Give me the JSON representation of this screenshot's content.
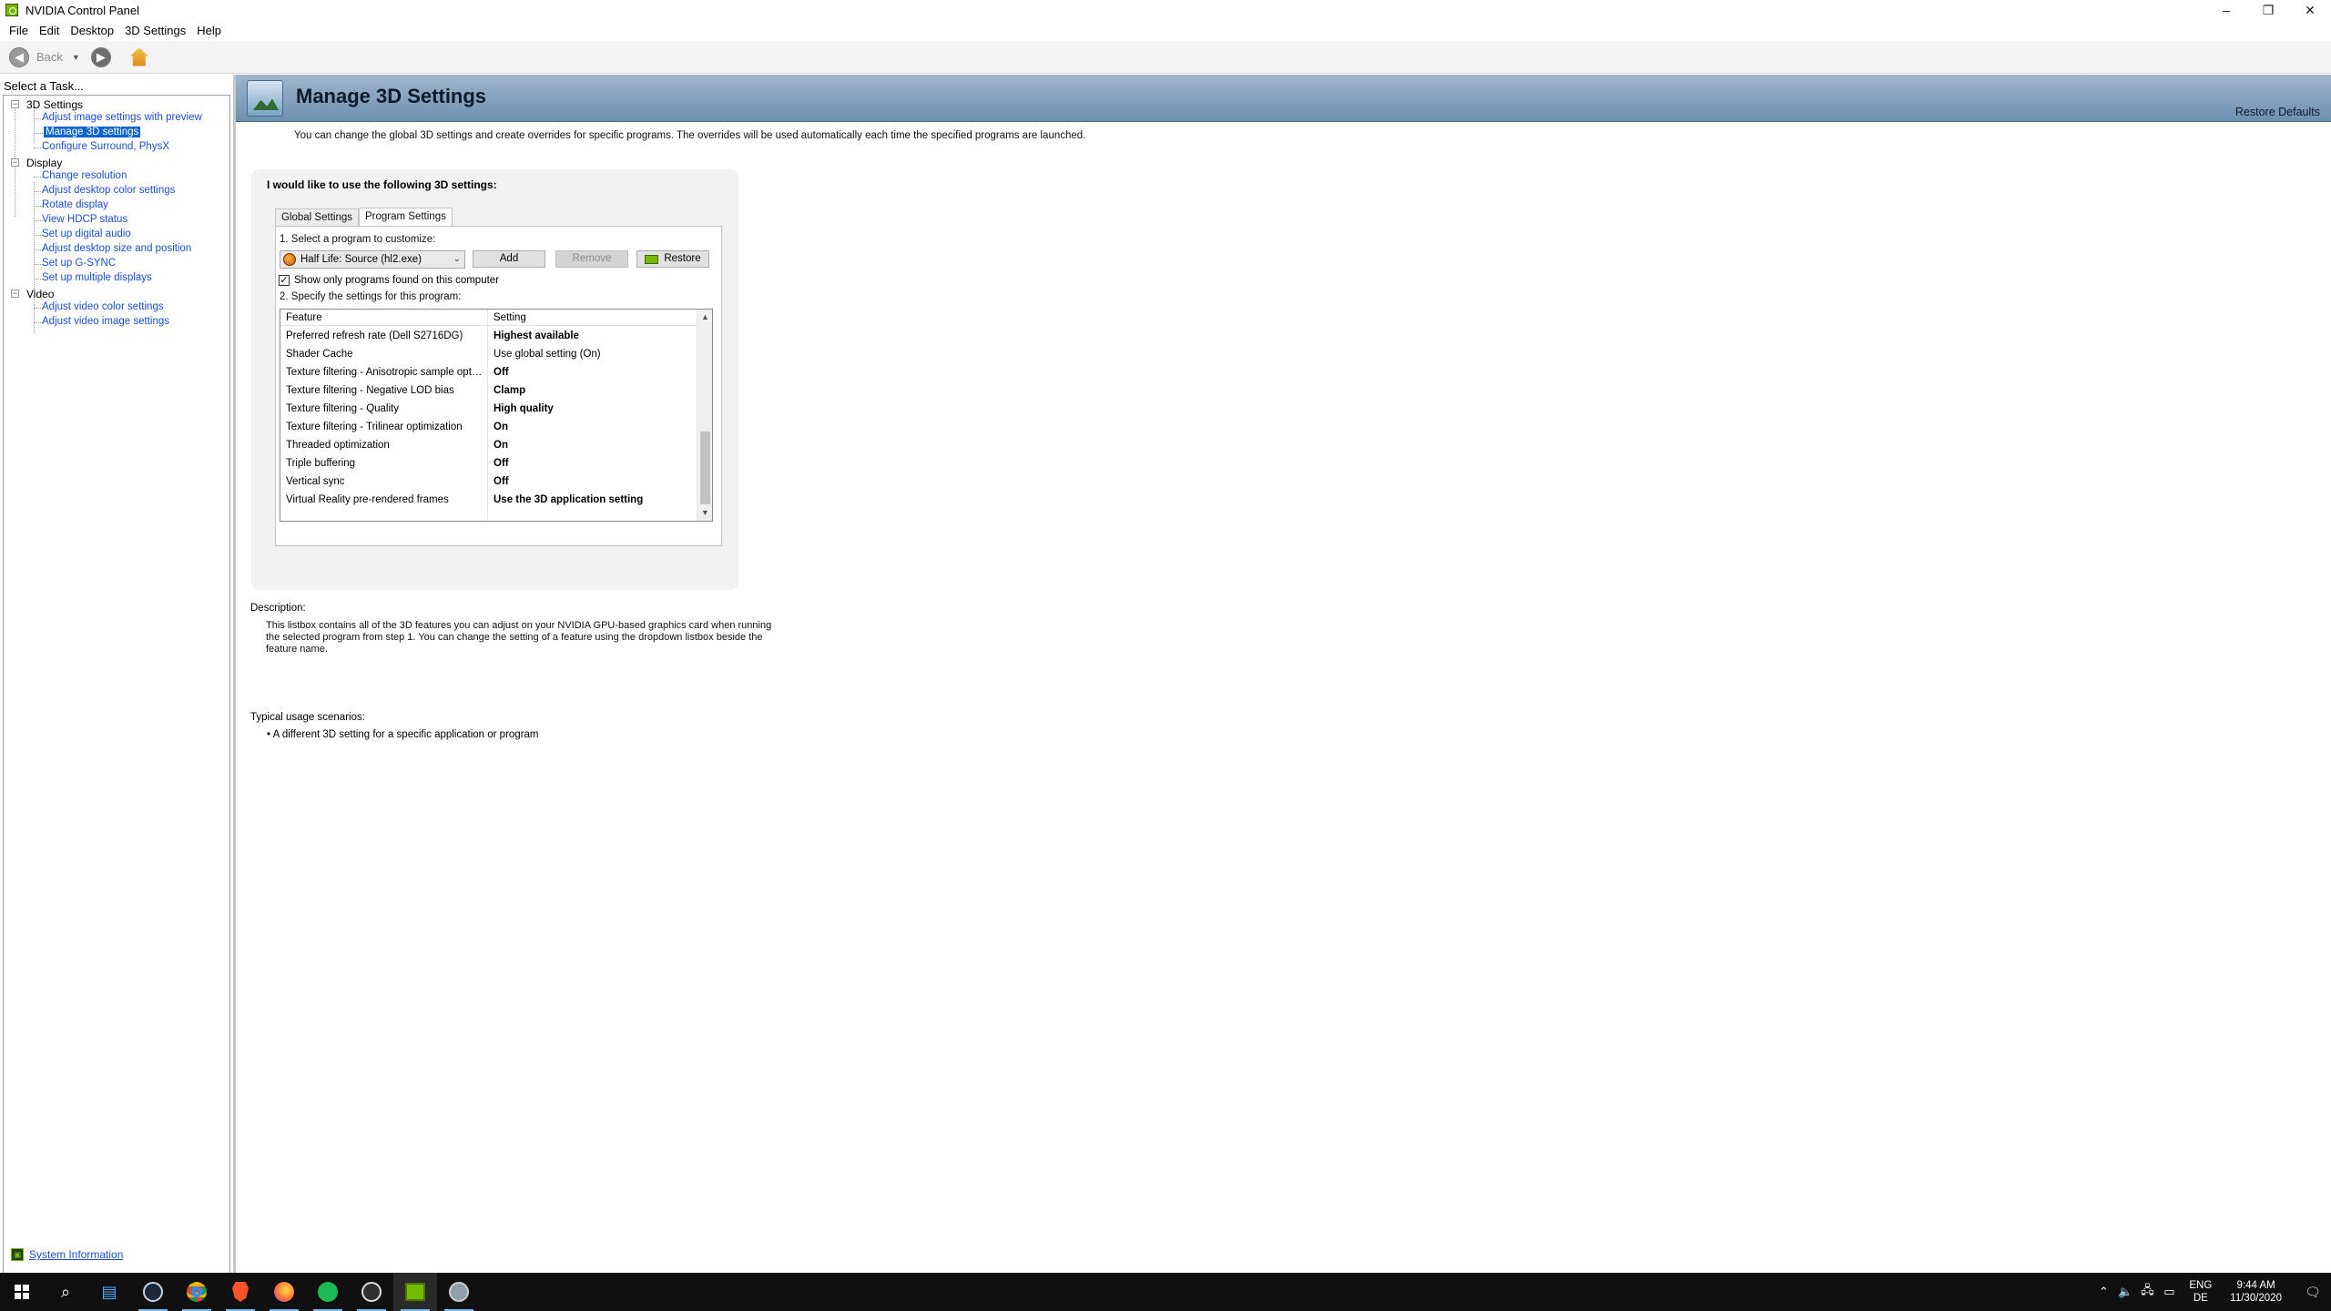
{
  "window": {
    "title": "NVIDIA Control Panel",
    "controls": {
      "minimize": "–",
      "restore": "❐",
      "close": "✕"
    }
  },
  "menu": [
    "File",
    "Edit",
    "Desktop",
    "3D Settings",
    "Help"
  ],
  "toolbar": {
    "back_label": "Back"
  },
  "left_pane": {
    "header": "Select a Task...",
    "groups": [
      {
        "label": "3D Settings",
        "items": [
          "Adjust image settings with preview",
          "Manage 3D settings",
          "Configure Surround, PhysX"
        ]
      },
      {
        "label": "Display",
        "items": [
          "Change resolution",
          "Adjust desktop color settings",
          "Rotate display",
          "View HDCP status",
          "Set up digital audio",
          "Adjust desktop size and position",
          "Set up G-SYNC",
          "Set up multiple displays"
        ]
      },
      {
        "label": "Video",
        "items": [
          "Adjust video color settings",
          "Adjust video image settings"
        ]
      }
    ],
    "selected": "Manage 3D settings",
    "system_info": "System Information"
  },
  "main": {
    "title": "Manage 3D Settings",
    "restore_defaults": "Restore Defaults",
    "intro": "You can change the global 3D settings and create overrides for specific programs. The overrides will be used automatically each time the specified programs are launched.",
    "panel_heading": "I would like to use the following 3D settings:",
    "tabs": [
      "Global Settings",
      "Program Settings"
    ],
    "active_tab": "Program Settings",
    "step1": "1. Select a program to customize:",
    "program": "Half Life: Source (hl2.exe)",
    "buttons": {
      "add": "Add",
      "remove": "Remove",
      "restore": "Restore"
    },
    "checkbox": {
      "label": "Show only programs found on this computer",
      "checked": true
    },
    "step2": "2. Specify the settings for this program:",
    "grid": {
      "headers": [
        "Feature",
        "Setting"
      ],
      "rows": [
        {
          "feature": "Preferred refresh rate (Dell S2716DG)",
          "setting": "Highest available",
          "bold": true
        },
        {
          "feature": "Shader Cache",
          "setting": "Use global setting (On)",
          "bold": false
        },
        {
          "feature": "Texture filtering - Anisotropic sample opti...",
          "setting": "Off",
          "bold": true
        },
        {
          "feature": "Texture filtering - Negative LOD bias",
          "setting": "Clamp",
          "bold": true
        },
        {
          "feature": "Texture filtering - Quality",
          "setting": "High quality",
          "bold": true
        },
        {
          "feature": "Texture filtering - Trilinear optimization",
          "setting": "On",
          "bold": true
        },
        {
          "feature": "Threaded optimization",
          "setting": "On",
          "bold": true
        },
        {
          "feature": "Triple buffering",
          "setting": "Off",
          "bold": true
        },
        {
          "feature": "Vertical sync",
          "setting": "Off",
          "bold": true
        },
        {
          "feature": "Virtual Reality pre-rendered frames",
          "setting": "Use the 3D application setting",
          "bold": true
        }
      ]
    },
    "description_label": "Description:",
    "description": "This listbox contains all of the 3D features you can adjust on your NVIDIA GPU-based graphics card when running the selected program from step 1. You can change the setting of a feature using the dropdown listbox beside the feature name.",
    "usage_label": "Typical usage scenarios:",
    "usage_items": [
      "A different 3D setting for a specific application or program"
    ]
  },
  "taskbar": {
    "icons": [
      "windows-start-icon",
      "search-icon",
      "task-view-icon",
      "steam-icon",
      "chrome-icon",
      "brave-icon",
      "firefox-icon",
      "spotify-icon",
      "obs-icon",
      "nvidia-icon",
      "app-icon"
    ],
    "lang": [
      "ENG",
      "DE"
    ],
    "time": "9:44 AM",
    "date": "11/30/2020"
  }
}
